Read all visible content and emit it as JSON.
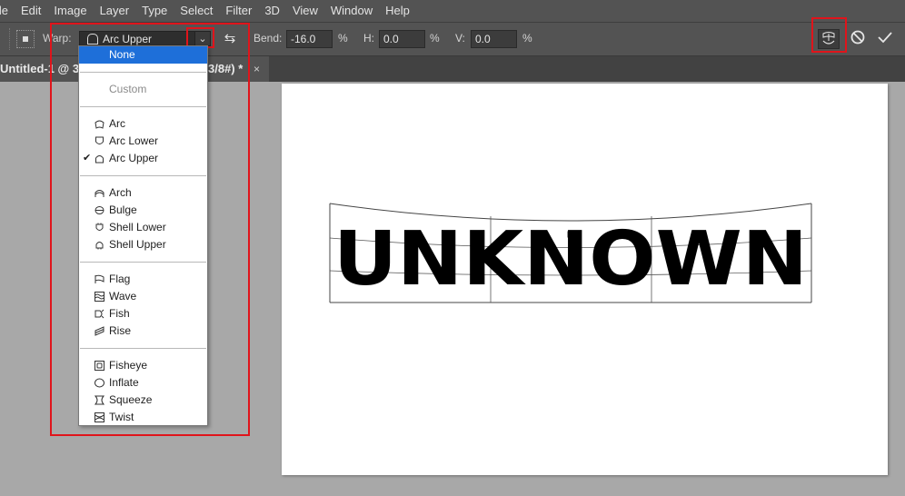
{
  "menu": {
    "items": [
      "ile",
      "Edit",
      "Image",
      "Layer",
      "Type",
      "Select",
      "Filter",
      "3D",
      "View",
      "Window",
      "Help"
    ]
  },
  "options": {
    "warp_label": "Warp:",
    "warp_value": "Arc Upper",
    "bend_label": "Bend:",
    "bend_value": "-16.0",
    "bend_unit": "%",
    "h_label": "H:",
    "h_value": "0.0",
    "h_unit": "%",
    "v_label": "V:",
    "v_value": "0.0",
    "v_unit": "%",
    "cancel_icon": "cancel-circle-icon",
    "commit_icon": "checkmark-icon"
  },
  "tab": {
    "title_left": "Untitled-1 @ 3",
    "title_right": "3/8#) *",
    "close": "×"
  },
  "canvas": {
    "text": "UNKNOWN"
  },
  "dropdown": {
    "items": [
      {
        "label": "None",
        "icon": "",
        "state": "selected"
      },
      {
        "label": "Custom",
        "icon": "",
        "state": "disabled"
      },
      {
        "label": "Arc",
        "icon": "arc-icon",
        "state": ""
      },
      {
        "label": "Arc Lower",
        "icon": "arc-lower-icon",
        "state": ""
      },
      {
        "label": "Arc Upper",
        "icon": "arc-upper-icon",
        "state": "checked"
      },
      {
        "label": "Arch",
        "icon": "arch-icon",
        "state": ""
      },
      {
        "label": "Bulge",
        "icon": "bulge-icon",
        "state": ""
      },
      {
        "label": "Shell Lower",
        "icon": "shell-lower-icon",
        "state": ""
      },
      {
        "label": "Shell Upper",
        "icon": "shell-upper-icon",
        "state": ""
      },
      {
        "label": "Flag",
        "icon": "flag-icon",
        "state": ""
      },
      {
        "label": "Wave",
        "icon": "wave-icon",
        "state": ""
      },
      {
        "label": "Fish",
        "icon": "fish-icon",
        "state": ""
      },
      {
        "label": "Rise",
        "icon": "rise-icon",
        "state": ""
      },
      {
        "label": "Fisheye",
        "icon": "fisheye-icon",
        "state": ""
      },
      {
        "label": "Inflate",
        "icon": "inflate-icon",
        "state": ""
      },
      {
        "label": "Squeeze",
        "icon": "squeeze-icon",
        "state": ""
      },
      {
        "label": "Twist",
        "icon": "twist-icon",
        "state": ""
      }
    ],
    "checkmark": "✔"
  },
  "colors": {
    "highlight": "#e0141b",
    "selection": "#1e6fd9",
    "panel": "#535353"
  }
}
